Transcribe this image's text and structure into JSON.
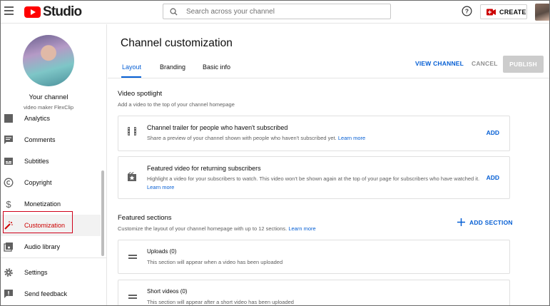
{
  "app": {
    "logo_text": "Studio",
    "search_placeholder": "Search across your channel",
    "create_label": "CREATE"
  },
  "sidebar": {
    "channel_title": "Your channel",
    "channel_name": "video maker FlexClip",
    "items": [
      {
        "label": "Analytics",
        "icon": "analytics-icon"
      },
      {
        "label": "Comments",
        "icon": "comments-icon"
      },
      {
        "label": "Subtitles",
        "icon": "subtitles-icon"
      },
      {
        "label": "Copyright",
        "icon": "copyright-icon"
      },
      {
        "label": "Monetization",
        "icon": "dollar-icon"
      },
      {
        "label": "Customization",
        "icon": "magic-wand-icon",
        "active": true
      },
      {
        "label": "Audio library",
        "icon": "audio-library-icon"
      },
      {
        "label": "Settings",
        "icon": "gear-icon"
      },
      {
        "label": "Send feedback",
        "icon": "feedback-icon"
      }
    ]
  },
  "main": {
    "title": "Channel customization",
    "tabs": [
      {
        "label": "Layout",
        "active": true
      },
      {
        "label": "Branding"
      },
      {
        "label": "Basic info"
      }
    ],
    "actions": {
      "view_channel": "VIEW CHANNEL",
      "cancel": "CANCEL",
      "publish": "PUBLISH"
    },
    "video_spotlight": {
      "title": "Video spotlight",
      "desc": "Add a video to the top of your channel homepage",
      "cards": [
        {
          "title": "Channel trailer for people who haven't subscribed",
          "desc": "Share a preview of your channel shown with people who haven't subscribed yet.",
          "link": "Learn more",
          "action": "ADD"
        },
        {
          "title": "Featured video for returning subscribers",
          "desc": "Highlight a video for your subscribers to watch. This video won't be shown again at the top of your page for subscribers who have watched it.",
          "link": "Learn more",
          "action": "ADD"
        }
      ]
    },
    "featured_sections": {
      "title": "Featured sections",
      "desc": "Customize the layout of your channel homepage with up to 12 sections.",
      "link": "Learn more",
      "add_section": "ADD SECTION",
      "sections": [
        {
          "title": "Uploads (0)",
          "desc": "This section will appear when a video has been uploaded"
        },
        {
          "title": "Short videos (0)",
          "desc": "This section will appear after a short video has been uploaded"
        }
      ]
    }
  },
  "colors": {
    "accent_blue": "#065fd4",
    "active_red": "#cc0000",
    "highlight_box": "#d0021b",
    "youtube_red": "#ff0000"
  }
}
